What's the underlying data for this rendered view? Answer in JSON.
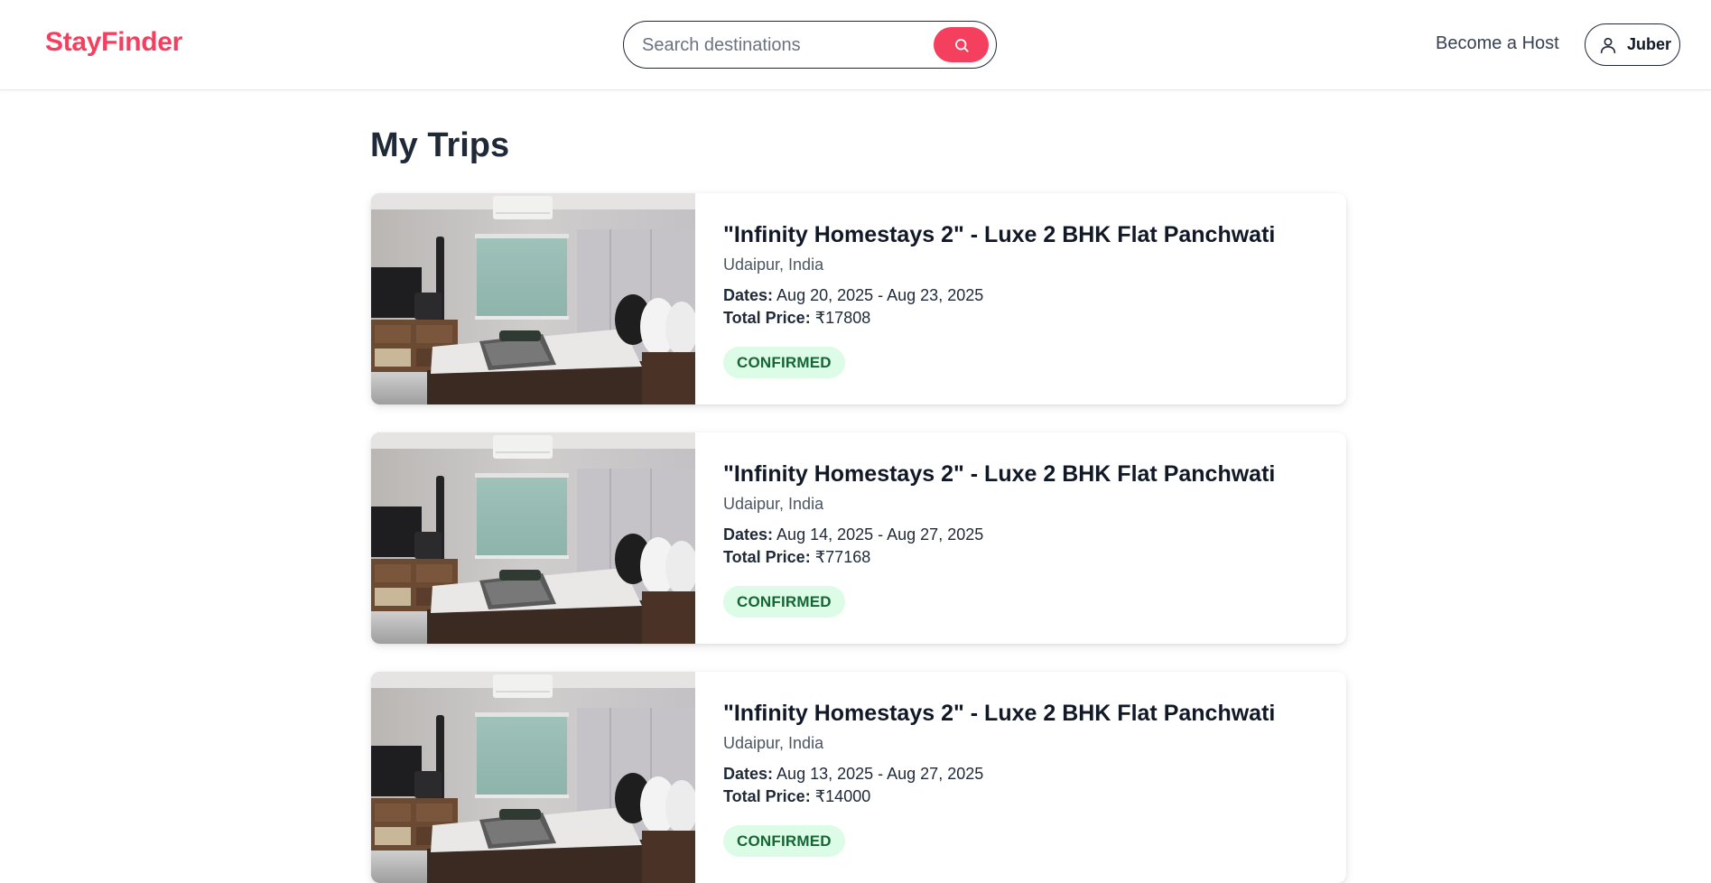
{
  "header": {
    "logo": "StayFinder",
    "search_placeholder": "Search destinations",
    "become_host": "Become a Host",
    "user_name": "Juber"
  },
  "page": {
    "title": "My Trips"
  },
  "labels": {
    "dates": "Dates:",
    "total_price": "Total Price:"
  },
  "trips": [
    {
      "title": "\"Infinity Homestays 2\" - Luxe 2 BHK Flat Panchwati",
      "location": "Udaipur, India",
      "dates": "Aug 20, 2025 - Aug 23, 2025",
      "price": "₹17808",
      "status": "CONFIRMED"
    },
    {
      "title": "\"Infinity Homestays 2\" - Luxe 2 BHK Flat Panchwati",
      "location": "Udaipur, India",
      "dates": "Aug 14, 2025 - Aug 27, 2025",
      "price": "₹77168",
      "status": "CONFIRMED"
    },
    {
      "title": "\"Infinity Homestays 2\" - Luxe 2 BHK Flat Panchwati",
      "location": "Udaipur, India",
      "dates": "Aug 13, 2025 - Aug 27, 2025",
      "price": "₹14000",
      "status": "CONFIRMED"
    }
  ],
  "colors": {
    "brand": "#f43f5e",
    "confirmed_bg": "#dcfce7",
    "confirmed_text": "#166534"
  }
}
